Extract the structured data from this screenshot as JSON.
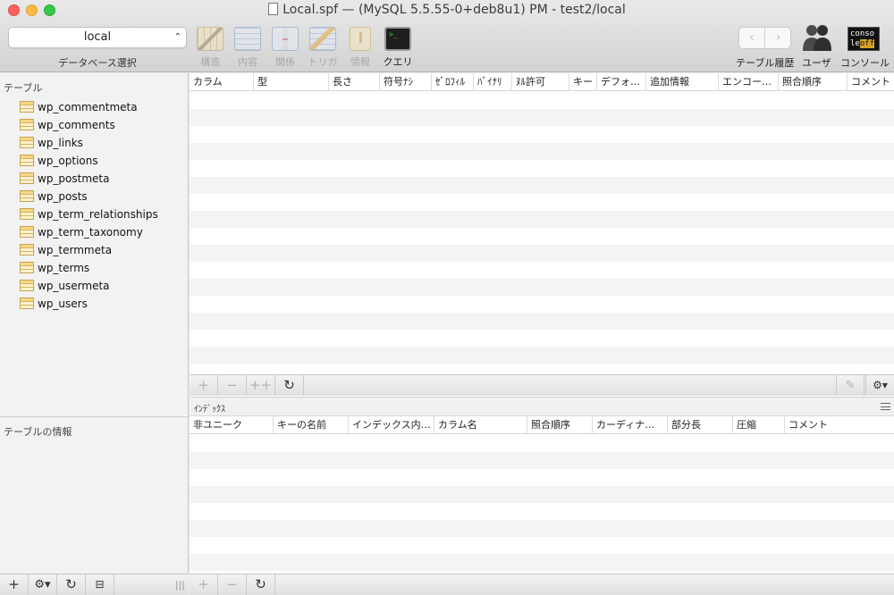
{
  "window": {
    "title": "Local.spf — (MySQL 5.5.55-0+deb8u1) PM - test2/local"
  },
  "toolbar": {
    "database_select": {
      "value": "local",
      "label": "データベース選択"
    },
    "buttons": [
      {
        "label": "構造",
        "icon": "structure-icon"
      },
      {
        "label": "内容",
        "icon": "content-icon"
      },
      {
        "label": "関係",
        "icon": "relations-icon"
      },
      {
        "label": "トリガ",
        "icon": "triggers-icon"
      },
      {
        "label": "情報",
        "icon": "info-icon"
      },
      {
        "label": "クエリ",
        "icon": "query-terminal-icon"
      }
    ],
    "history_label": "テーブル履歴",
    "users_label": "ユーザ",
    "console_label": "コンソール",
    "console_icon_text": {
      "line1": "conso",
      "line2a": "le",
      "line2b": "off"
    }
  },
  "sidebar": {
    "header": "テーブル",
    "tables": [
      "wp_commentmeta",
      "wp_comments",
      "wp_links",
      "wp_options",
      "wp_postmeta",
      "wp_posts",
      "wp_term_relationships",
      "wp_term_taxonomy",
      "wp_termmeta",
      "wp_terms",
      "wp_usermeta",
      "wp_users"
    ],
    "table_info_header": "テーブルの情報"
  },
  "structure": {
    "columns": [
      "カラム",
      "型",
      "長さ",
      "符号ﾅｼ",
      "ｾﾞﾛﾌｨﾙ",
      "ﾊﾞｲﾅﾘ",
      "ﾇﾙ許可",
      "キー",
      "デフォ…",
      "追加情報",
      "エンコー…",
      "照合順序",
      "コメント"
    ]
  },
  "indexes": {
    "title": "ｲﾝﾃﾞｯｸｽ",
    "columns": [
      "非ユニーク",
      "キーの名前",
      "インデックス内…",
      "カラム名",
      "照合順序",
      "カーディナ…",
      "部分長",
      "圧縮",
      "コメント"
    ]
  },
  "colors": {
    "close": "#fc605c",
    "minimize": "#fdbc40",
    "maximize": "#34c84a"
  }
}
